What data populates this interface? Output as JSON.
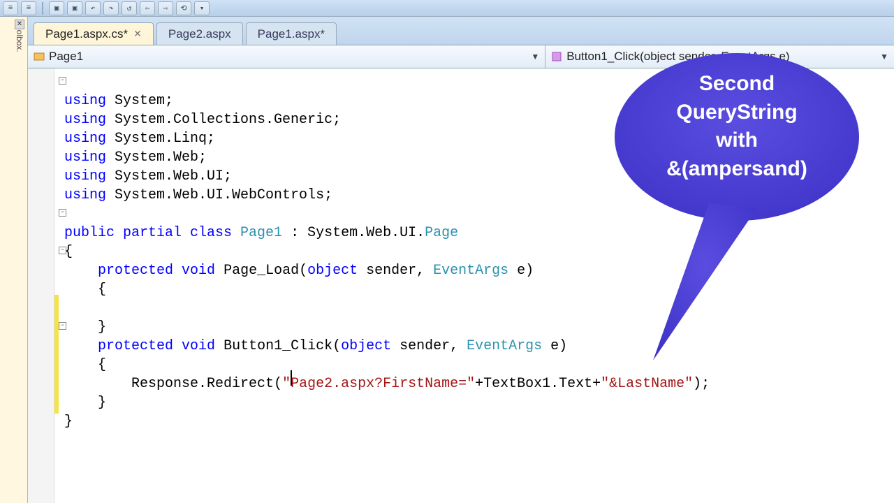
{
  "toolbox_label": "Toolbox.",
  "tabs": [
    {
      "label": "Page1.aspx.cs*",
      "active": true,
      "closable": true
    },
    {
      "label": "Page2.aspx",
      "active": false,
      "closable": false
    },
    {
      "label": "Page1.aspx*",
      "active": false,
      "closable": false
    }
  ],
  "combo_left": "Page1",
  "combo_right": "Button1_Click(object sender, EventArgs e)",
  "code": {
    "l1": {
      "kw": "using",
      "rest": " System;"
    },
    "l2": {
      "kw": "using",
      "rest": " System.Collections.Generic;"
    },
    "l3": {
      "kw": "using",
      "rest": " System.Linq;"
    },
    "l4": {
      "kw": "using",
      "rest": " System.Web;"
    },
    "l5": {
      "kw": "using",
      "rest": " System.Web.UI;"
    },
    "l6": {
      "kw": "using",
      "rest": " System.Web.UI.WebControls;"
    },
    "cls": {
      "p1": "public",
      "p2": " partial",
      "p3": " class",
      "name": " Page1",
      "colon": " : System.Web.UI.",
      "base": "Page"
    },
    "m1": {
      "p": "protected",
      "v": " void",
      "sig": " Page_Load(",
      "ob": "object",
      "mid": " sender, ",
      "ea": "EventArgs",
      "end": " e)"
    },
    "m2": {
      "p": "protected",
      "v": " void",
      "sig": " Button1_Click(",
      "ob": "object",
      "mid": " sender, ",
      "ea": "EventArgs",
      "end": " e)"
    },
    "redir": {
      "pre": "        Response.Redirect(",
      "s1": "\"Page2.aspx?FirstName=\"",
      "mid": "+TextBox1.Text+",
      "s2": "\"&LastName\"",
      "post": ");"
    },
    "brace_open": "{",
    "brace_close": "}",
    "brace_open_indent": "    {",
    "brace_close_indent": "    }"
  },
  "callout": {
    "l1": "Second",
    "l2": "QueryString",
    "l3": "with",
    "l4": "&(ampersand)"
  }
}
